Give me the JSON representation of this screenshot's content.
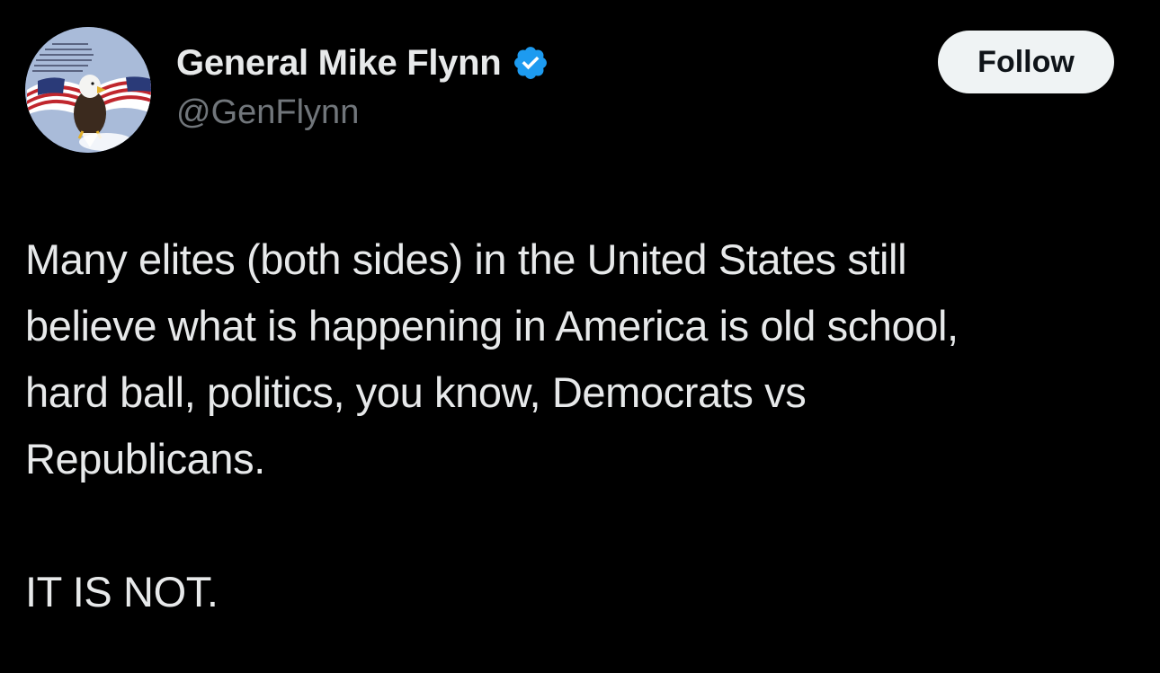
{
  "author": {
    "display_name": "General Mike Flynn",
    "handle": "@GenFlynn",
    "verified": true,
    "verified_color": "#1d9bf0"
  },
  "actions": {
    "follow_label": "Follow"
  },
  "tweet": {
    "lines": [
      "Many elites (both sides) in the United States still",
      "believe what is happening in America is old school,",
      "hard ball, politics, you know, Democrats vs",
      "Republicans."
    ],
    "closing_line": "IT IS NOT."
  },
  "theme": {
    "background": "#000000",
    "text": "#e7e9ea",
    "muted": "#71767b",
    "button_bg": "#eff3f4"
  },
  "icons": {
    "avatar": "eagle-flag-avatar",
    "verified": "verified-badge-icon"
  }
}
